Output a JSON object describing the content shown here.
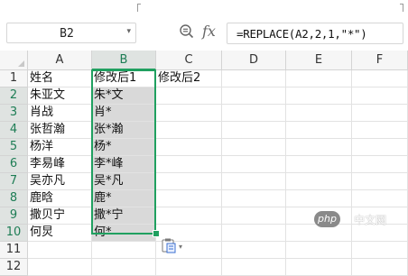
{
  "namebox": {
    "value": "B2",
    "arrow": "▾"
  },
  "formula_bar": {
    "fx_label": "fx",
    "formula": "=REPLACE(A2,2,1,\"*\")"
  },
  "columns": [
    "A",
    "B",
    "C",
    "D",
    "E",
    "F"
  ],
  "rows": [
    "1",
    "2",
    "3",
    "4",
    "5",
    "6",
    "7",
    "8",
    "9",
    "10",
    "11",
    "12"
  ],
  "cells": {
    "A": [
      "姓名",
      "朱亚文",
      "肖战",
      "张哲瀚",
      "杨洋",
      "李易峰",
      "吴亦凡",
      "鹿晗",
      "撒贝宁",
      "何炅",
      "",
      ""
    ],
    "B": [
      "修改后1",
      "朱*文",
      "肖*",
      "张*瀚",
      "杨*",
      "李*峰",
      "吴*凡",
      "鹿*",
      "撒*宁",
      "何*",
      "",
      ""
    ],
    "C": [
      "修改后2",
      "",
      "",
      "",
      "",
      "",
      "",
      "",
      "",
      "",
      "",
      ""
    ]
  },
  "selection": {
    "range": "B2:B10",
    "accent_color": "#20a060"
  },
  "paste_options": {
    "icon": "paste-options-icon",
    "arrow": "▾"
  },
  "watermark": {
    "logo": "php",
    "text": "中文网"
  }
}
